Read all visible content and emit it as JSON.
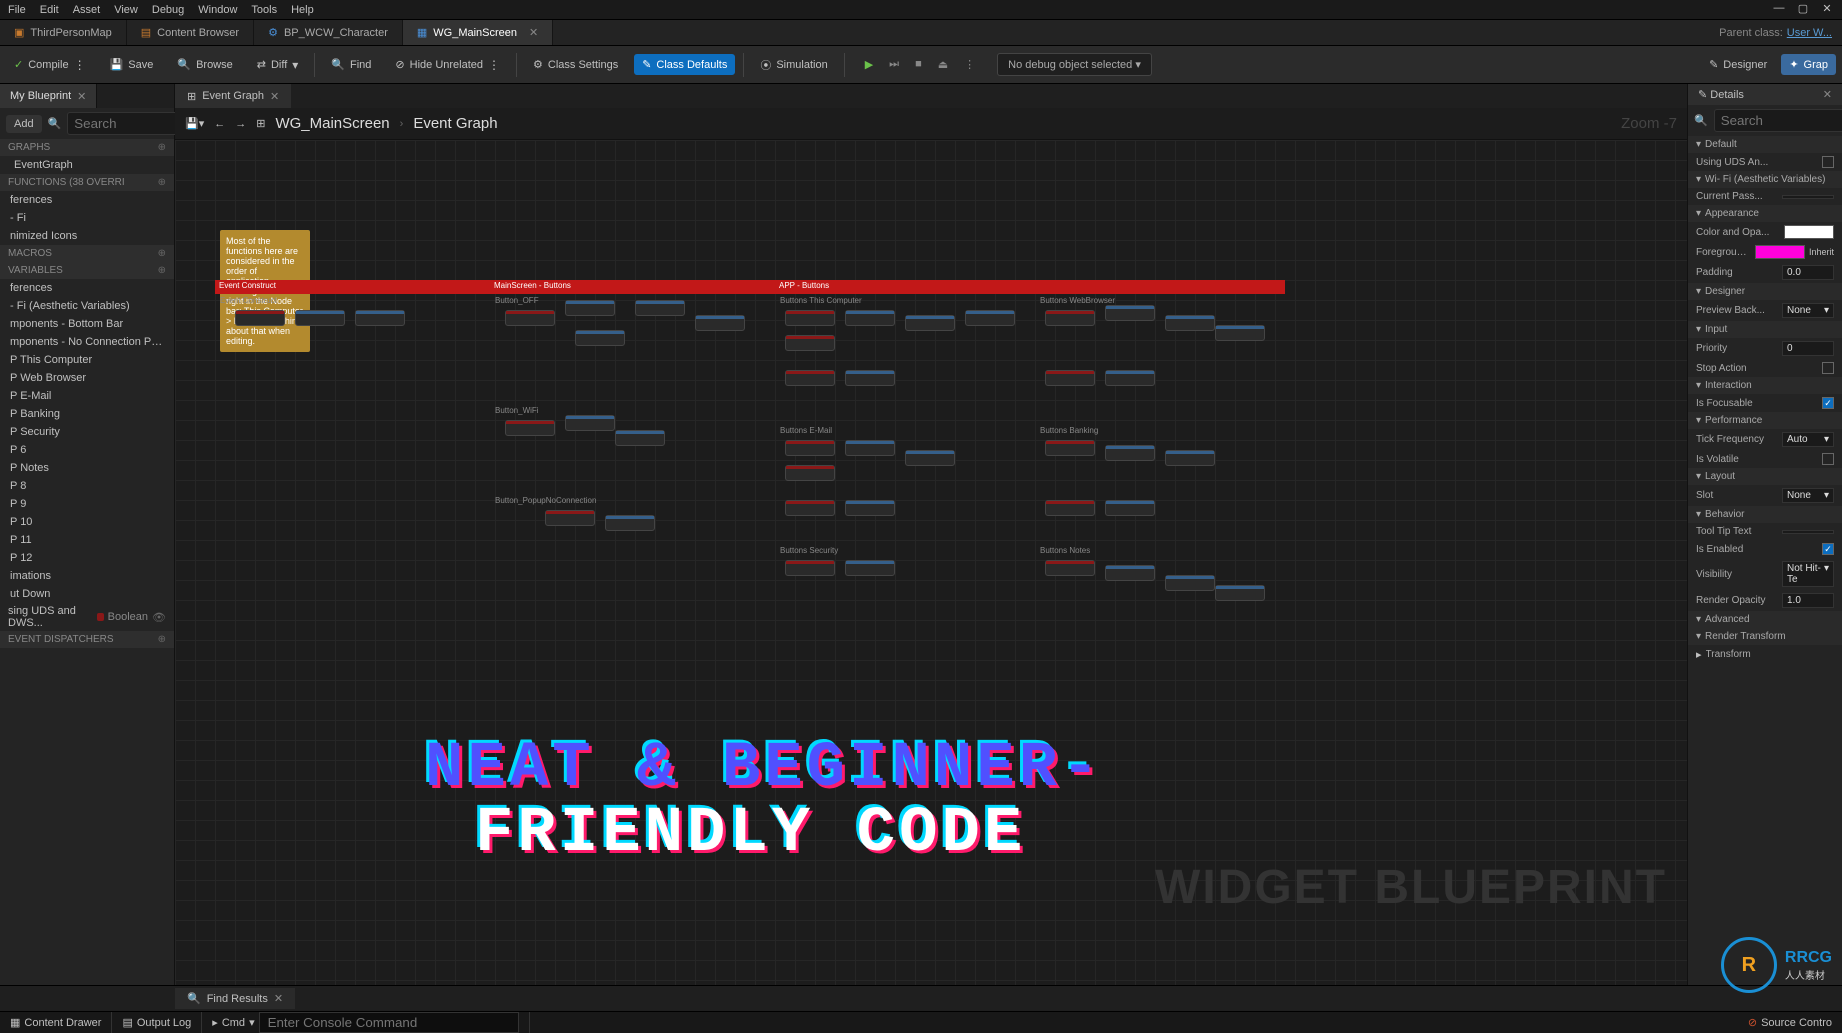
{
  "top_menu": [
    "File",
    "Edit",
    "Asset",
    "View",
    "Debug",
    "Window",
    "Tools",
    "Help"
  ],
  "file_tabs": [
    {
      "label": "ThirdPersonMap",
      "active": false
    },
    {
      "label": "Content Browser",
      "active": false
    },
    {
      "label": "BP_WCW_Character",
      "active": false
    },
    {
      "label": "WG_MainScreen",
      "active": true
    }
  ],
  "parent_class": {
    "label": "Parent class:",
    "value": "User W..."
  },
  "toolbar": {
    "compile": "Compile",
    "save": "Save",
    "browse": "Browse",
    "diff": "Diff",
    "find": "Find",
    "hide": "Hide Unrelated",
    "class_settings": "Class Settings",
    "class_defaults": "Class Defaults",
    "simulation": "Simulation",
    "debug_select": "No debug object selected",
    "designer": "Designer",
    "graph": "Grap"
  },
  "left": {
    "tab": "My Blueprint",
    "add": "Add",
    "search": "Search",
    "gear": "⚙",
    "sections": {
      "graphs": {
        "name": "GRAPHS",
        "items": [
          "EventGraph"
        ]
      },
      "functions": {
        "name": "FUNCTIONS (38 OVERRI"
      },
      "func_items": [
        "ferences",
        "- Fi",
        "nimized Icons"
      ],
      "macros": {
        "name": "MACROS"
      },
      "variables": {
        "name": "VARIABLES"
      },
      "var_items": [
        "ferences",
        "- Fi (Aesthetic Variables)",
        "mponents - Bottom Bar",
        "mponents - No Connection Popup",
        "P This Computer",
        "P Web Browser",
        "P E-Mail",
        "P Banking",
        "P Security",
        "P 6",
        "P Notes",
        "P 8",
        "P 9",
        "P 10",
        "P 11",
        "P 12",
        "imations",
        "ut Down"
      ],
      "var_typed": {
        "name": "sing UDS and DWS...",
        "type": "Boolean"
      },
      "dispatchers": {
        "name": "EVENT DISPATCHERS"
      }
    }
  },
  "graph": {
    "tab": "Event Graph",
    "breadcrumb": {
      "asset": "WG_MainScreen",
      "graph": "Event Graph"
    },
    "zoom": "Zoom -7",
    "comment": "Most of the functions here are considered in the order of application. Starting from left to right in the Node bar: This Computer > E-Mail > ... Think about that when editing.",
    "regions": [
      "Event Construct",
      "MainScreen - Buttons",
      "APP - Buttons"
    ],
    "sub_labels": [
      "Event Construct",
      "Button_OFF",
      "Buttons This Computer",
      "Buttons WebBrowser",
      "Button_WiFi",
      "Buttons E-Mail",
      "Buttons Banking",
      "Button_PopupNoConnection",
      "Buttons Security",
      "Buttons Notes"
    ],
    "watermark": "WIDGET BLUEPRINT",
    "overlay": {
      "line1": "NEAT & BEGINNER-",
      "line2": "FRIENDLY CODE"
    }
  },
  "details": {
    "tab": "Details",
    "search": "Search",
    "sections": [
      {
        "name": "Default",
        "rows": [
          {
            "label": "Using UDS An...",
            "type": "check"
          }
        ]
      },
      {
        "name": "Wi- Fi (Aesthetic Variables)",
        "rows": [
          {
            "label": "Current Pass...",
            "type": "text",
            "value": ""
          }
        ]
      },
      {
        "name": "Appearance",
        "rows": [
          {
            "label": "Color and Opa...",
            "type": "swatch",
            "color": "white"
          },
          {
            "label": "Foreground Colo",
            "type": "swatch",
            "color": "magenta",
            "extra": "Inherit"
          },
          {
            "label": "Padding",
            "type": "value",
            "value": "0.0"
          }
        ]
      },
      {
        "name": "Designer",
        "rows": [
          {
            "label": "Preview Back...",
            "type": "dropdown",
            "value": "None"
          }
        ]
      },
      {
        "name": "Input",
        "rows": [
          {
            "label": "Priority",
            "type": "value",
            "value": "0"
          },
          {
            "label": "Stop Action",
            "type": "check"
          }
        ]
      },
      {
        "name": "Interaction",
        "rows": [
          {
            "label": "Is Focusable",
            "type": "check",
            "checked": true
          }
        ]
      },
      {
        "name": "Performance",
        "rows": [
          {
            "label": "Tick Frequency",
            "type": "dropdown",
            "value": "Auto"
          },
          {
            "label": "Is Volatile",
            "type": "check"
          }
        ]
      },
      {
        "name": "Layout",
        "rows": [
          {
            "label": "Slot",
            "type": "dropdown",
            "value": "None"
          }
        ]
      },
      {
        "name": "Behavior",
        "rows": [
          {
            "label": "Tool Tip Text",
            "type": "text",
            "value": ""
          },
          {
            "label": "Is Enabled",
            "type": "check",
            "checked": true
          },
          {
            "label": "Visibility",
            "type": "dropdown",
            "value": "Not Hit-Te"
          },
          {
            "label": "Render Opacity",
            "type": "value",
            "value": "1.0"
          }
        ]
      },
      {
        "name": "Advanced",
        "collapsed": true
      },
      {
        "name": "Render Transform",
        "rows": [
          {
            "label": "Transform",
            "type": "expand"
          }
        ]
      }
    ]
  },
  "findbar": "Find Results",
  "bottom": {
    "drawer": "Content Drawer",
    "log": "Output Log",
    "cmd_label": "Cmd",
    "cmd_placeholder": "Enter Console Command",
    "source": "Source Contro"
  },
  "logo": {
    "text": "RRCG",
    "sub": "人人素材"
  }
}
